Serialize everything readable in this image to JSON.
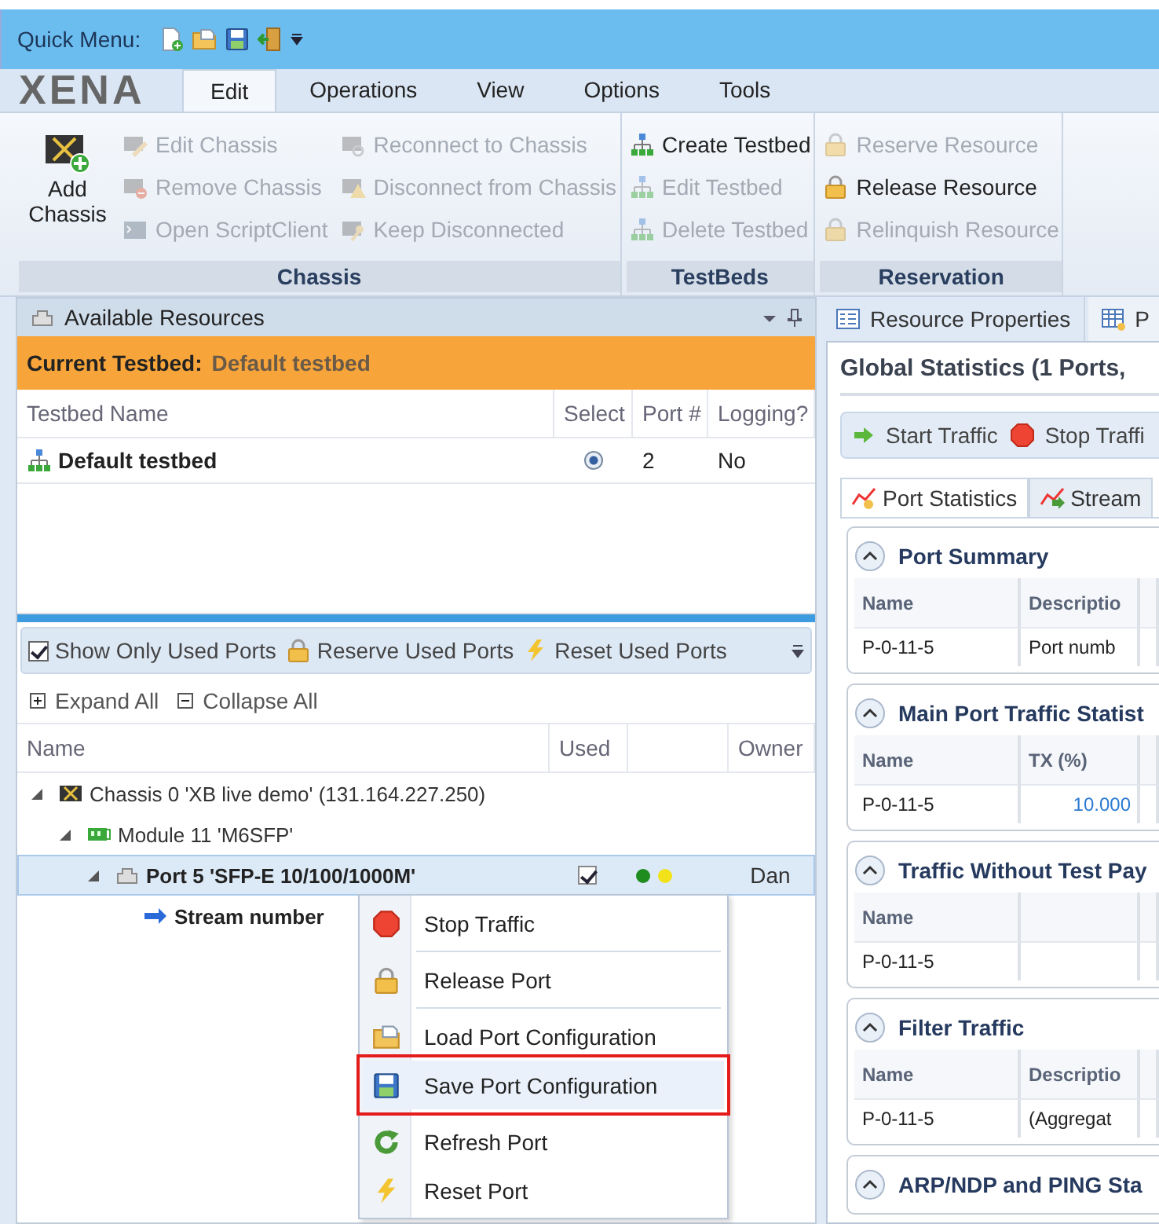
{
  "quick_menu": {
    "label": "Quick Menu:"
  },
  "ribbon": {
    "logo": "XENA",
    "tabs": [
      {
        "label": "Edit",
        "selected": true
      },
      {
        "label": "Operations",
        "selected": false
      },
      {
        "label": "View",
        "selected": false
      },
      {
        "label": "Options",
        "selected": false
      },
      {
        "label": "Tools",
        "selected": false
      }
    ],
    "groups": [
      {
        "label": "Chassis",
        "items": [
          {
            "kind": "large",
            "label": "Add Chassis",
            "disabled": false
          },
          {
            "kind": "small",
            "label": "Edit Chassis",
            "disabled": true
          },
          {
            "kind": "small",
            "label": "Remove Chassis",
            "disabled": true
          },
          {
            "kind": "small",
            "label": "Open ScriptClient",
            "disabled": true
          },
          {
            "kind": "small",
            "label": "Reconnect to Chassis",
            "disabled": true
          },
          {
            "kind": "small",
            "label": "Disconnect from Chassis",
            "disabled": true
          },
          {
            "kind": "small",
            "label": "Keep Disconnected",
            "disabled": true
          }
        ]
      },
      {
        "label": "TestBeds",
        "items": [
          {
            "kind": "small",
            "label": "Create Testbed",
            "disabled": false
          },
          {
            "kind": "small",
            "label": "Edit Testbed",
            "disabled": true
          },
          {
            "kind": "small",
            "label": "Delete Testbed",
            "disabled": true
          }
        ]
      },
      {
        "label": "Reservation",
        "items": [
          {
            "kind": "small",
            "label": "Reserve Resource",
            "disabled": true
          },
          {
            "kind": "small",
            "label": "Release Resource",
            "disabled": false
          },
          {
            "kind": "small",
            "label": "Relinquish Resource",
            "disabled": true
          }
        ]
      }
    ]
  },
  "available_resources": {
    "title": "Available Resources",
    "current_label": "Current Testbed:",
    "current_value": "Default testbed",
    "columns": [
      "Testbed Name",
      "Select",
      "Port #",
      "Logging?"
    ],
    "rows": [
      {
        "name": "Default testbed",
        "selected": true,
        "port_count": "2",
        "logging": "No"
      }
    ]
  },
  "ports_toolbar": [
    {
      "kind": "checkbox",
      "label": "Show Only Used Ports",
      "checked": true
    },
    {
      "kind": "button",
      "label": "Reserve Used Ports"
    },
    {
      "kind": "button",
      "label": "Reset Used Ports"
    }
  ],
  "tree_tools": [
    {
      "label": "Expand All"
    },
    {
      "label": "Collapse All"
    }
  ],
  "port_tree": {
    "columns": [
      "Name",
      "Used",
      "Owner"
    ],
    "nodes": [
      {
        "kind": "chassis",
        "label": "Chassis 0 'XB live demo' (131.164.227.250)",
        "expanded": true,
        "selected": false,
        "children": [
          {
            "kind": "module",
            "label": "Module 11 'M6SFP'",
            "expanded": true,
            "selected": false,
            "children": [
              {
                "kind": "port",
                "label": "Port 5 'SFP-E 10/100/1000M'",
                "expanded": true,
                "selected": true,
                "used": true,
                "status": [
                  {
                    "color": "#1e8c1e"
                  },
                  {
                    "color": "#f2e21a"
                  }
                ],
                "owner": "Dan",
                "children": [
                  {
                    "kind": "stream",
                    "label": "Stream number",
                    "selected": false
                  }
                ]
              }
            ]
          }
        ]
      }
    ]
  },
  "context_menu": {
    "groups": [
      {
        "items": [
          {
            "label": "Stop Traffic",
            "selected": false
          }
        ]
      },
      {
        "items": [
          {
            "label": "Release Port",
            "selected": false
          }
        ]
      },
      {
        "items": [
          {
            "label": "Load Port Configuration",
            "selected": false
          },
          {
            "label": "Save Port Configuration",
            "selected": true
          }
        ]
      },
      {
        "items": [
          {
            "label": "Refresh Port",
            "selected": false
          },
          {
            "label": "Reset Port",
            "selected": false
          }
        ]
      }
    ]
  },
  "right_panel": {
    "tabs": [
      {
        "label": "Resource Properties",
        "selected": false
      },
      {
        "label": "P",
        "selected": true
      }
    ],
    "title": "Global Statistics (1 Ports,",
    "toolbar": [
      {
        "label": "Start Traffic"
      },
      {
        "label": "Stop Traffi"
      }
    ],
    "subtabs": [
      {
        "label": "Port Statistics",
        "selected": true
      },
      {
        "label": "Stream",
        "selected": false
      }
    ],
    "sections": [
      {
        "title": "Port Summary",
        "expanded": true,
        "columns": [
          "Name",
          "Descriptio"
        ],
        "rows": [
          [
            "P-0-11-5",
            "Port numb"
          ]
        ]
      },
      {
        "title": "Main Port Traffic Statist",
        "expanded": true,
        "columns": [
          "Name",
          "TX (%)"
        ],
        "rows": [
          [
            "P-0-11-5",
            {
              "text": "10.000",
              "kind": "number"
            }
          ]
        ]
      },
      {
        "title": "Traffic Without Test Pay",
        "expanded": true,
        "columns": [
          "Name"
        ],
        "rows": [
          [
            "P-0-11-5"
          ]
        ]
      },
      {
        "title": "Filter Traffic",
        "expanded": true,
        "columns": [
          "Name",
          "Descriptio"
        ],
        "rows": [
          [
            "P-0-11-5",
            "(Aggregat"
          ]
        ]
      },
      {
        "title": "ARP/NDP and PING Sta",
        "expanded": true
      }
    ]
  }
}
